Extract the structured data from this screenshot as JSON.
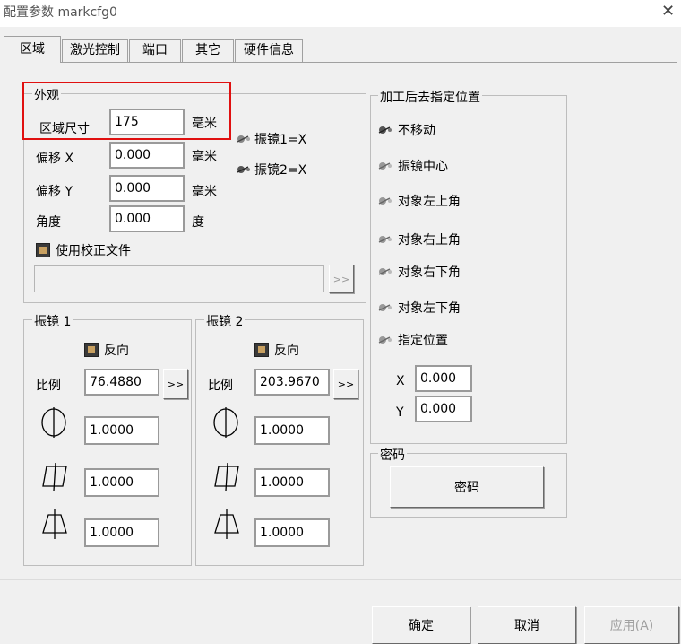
{
  "window": {
    "title": "配置参数 markcfg0",
    "close_glyph": "✕"
  },
  "tabs": [
    {
      "label": "区域",
      "active": true
    },
    {
      "label": "激光控制"
    },
    {
      "label": "端口"
    },
    {
      "label": "其它"
    },
    {
      "label": "硬件信息"
    }
  ],
  "appearance": {
    "title": "外观",
    "size_label": "区域尺寸",
    "size_value": "175",
    "size_unit": "毫米",
    "offset_x_label": "偏移 X",
    "offset_x_value": "0.000",
    "offset_x_unit": "毫米",
    "offset_y_label": "偏移 Y",
    "offset_y_value": "0.000",
    "offset_y_unit": "毫米",
    "angle_label": "角度",
    "angle_value": "0.000",
    "angle_unit": "度",
    "galvo1_x": "振镜1=X",
    "galvo2_x": "振镜2=X",
    "use_correction_label": "使用校正文件",
    "correction_path": "",
    "browse_label": ">>"
  },
  "galvo1": {
    "title": "振镜 1",
    "reverse_label": "反向",
    "scale_label": "比例",
    "scale_value": "76.4880",
    "scale_btn": ">>",
    "v1": "1.0000",
    "v2": "1.0000",
    "v3": "1.0000"
  },
  "galvo2": {
    "title": "振镜 2",
    "reverse_label": "反向",
    "scale_label": "比例",
    "scale_value": "203.9670",
    "scale_btn": ">>",
    "v1": "1.0000",
    "v2": "1.0000",
    "v3": "1.0000"
  },
  "after_process": {
    "title": "加工后去指定位置",
    "options": [
      "不移动",
      "振镜中心",
      "对象左上角",
      "对象右上角",
      "对象右下角",
      "对象左下角",
      "指定位置"
    ],
    "selected_index": 0,
    "x_label": "X",
    "x_value": "0.000",
    "y_label": "Y",
    "y_value": "0.000"
  },
  "password": {
    "title": "密码",
    "button_label": "密码"
  },
  "footer": {
    "ok_label": "确定",
    "cancel_label": "取消",
    "apply_label": "应用(A)"
  }
}
